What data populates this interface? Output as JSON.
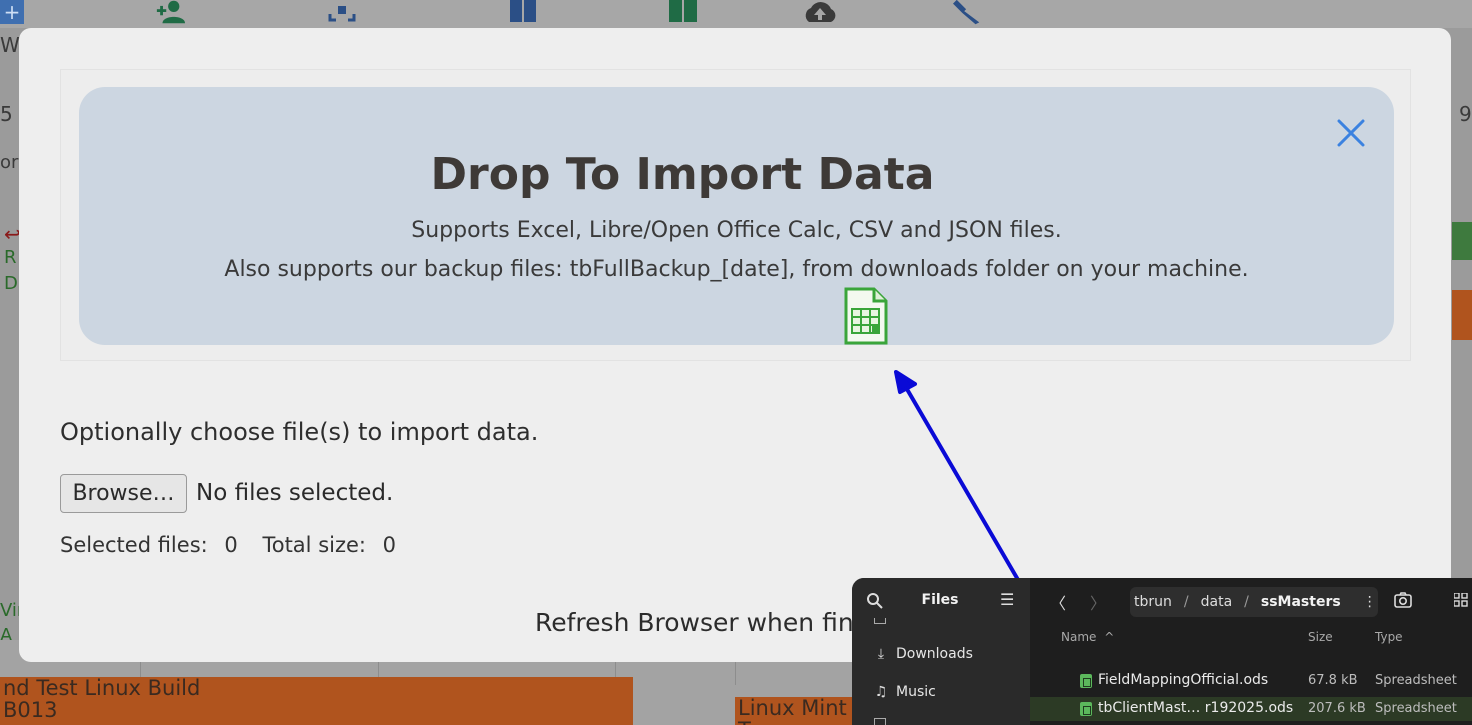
{
  "dialog": {
    "drop_title": "Drop To Import Data",
    "drop_sub1": "Supports Excel, Libre/Open Office Calc, CSV and JSON files.",
    "drop_sub2": "Also supports our backup files: tbFullBackup_[date], from downloads folder on your machine.",
    "choose_label": "Optionally choose file(s) to import data.",
    "browse_label": "Browse…",
    "no_files_label": "No files selected.",
    "selected_files_label": "Selected files:",
    "selected_files_value": "0",
    "total_size_label": "Total size:",
    "total_size_value": "0",
    "refresh_text": "Refresh Browser when fin"
  },
  "background": {
    "bar1_line1": "nd Test Linux Build",
    "bar1_line2": "B013",
    "bar2": "Linux Mint T",
    "edge_w": "W",
    "edge_5": "5",
    "edge_9": "9",
    "edge_ork": "ork",
    "edge_r": "R",
    "edge_d": "D",
    "edge_vir": "Vir",
    "edge_a": "A"
  },
  "files_window": {
    "title": "Files",
    "sidebar_items": [
      {
        "label": "Downloads",
        "icon": "download-icon"
      },
      {
        "label": "Music",
        "icon": "music-icon"
      }
    ],
    "path": {
      "segment1": "tbrun",
      "segment2": "data",
      "segment3": "ssMasters"
    },
    "columns": {
      "name": "Name",
      "size": "Size",
      "type": "Type"
    },
    "rows": [
      {
        "name": "FieldMappingOfficial.ods",
        "size": "67.8 kB",
        "type": "Spreadsheet"
      },
      {
        "name": "tbClientMast…   r192025.ods",
        "size": "207.6 kB",
        "type": "Spreadsheet"
      }
    ]
  },
  "colors": {
    "dropzone": "#ccd6e1",
    "close_icon": "#3b82e0",
    "arrow": "#0a0ad6",
    "spreadsheet_icon": "#3aa53a",
    "bg_bar": "#b0541e"
  }
}
